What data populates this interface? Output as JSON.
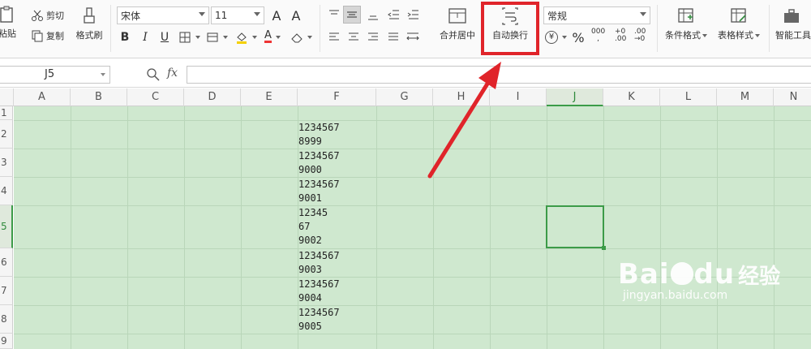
{
  "ribbon": {
    "paste_label": "粘贴",
    "cut_label": "剪切",
    "copy_label": "复制",
    "format_painter_label": "格式刷",
    "font_name": "宋体",
    "font_size": "11",
    "font_grow": "A⁺",
    "font_shrink": "A⁻",
    "merge_center_label": "合并居中",
    "wrap_text_label": "自动换行",
    "number_format": "常规",
    "currency_symbol": "¥",
    "percent_symbol": "%",
    "thousands_symbol": "000",
    "inc_decimal": "+0\n.00",
    "dec_decimal": ".00\n→0",
    "conditional_format_label": "条件格式",
    "table_style_label": "表格样式",
    "smart_tools_label": "智能工具"
  },
  "formula_bar": {
    "name_box": "J5",
    "fx_label": "fx",
    "formula": ""
  },
  "columns": [
    "A",
    "B",
    "C",
    "D",
    "E",
    "F",
    "G",
    "H",
    "I",
    "J",
    "K",
    "L",
    "M",
    "N"
  ],
  "active_column": "J",
  "rows": [
    "1",
    "2",
    "3",
    "4",
    "5",
    "6",
    "7",
    "8",
    "9"
  ],
  "active_row": "5",
  "column_f_cells": [
    {
      "row": "2",
      "lines": "1234567\n8999"
    },
    {
      "row": "3",
      "lines": "1234567\n9000"
    },
    {
      "row": "4",
      "lines": "1234567\n9001"
    },
    {
      "row": "5",
      "lines": "12345\n67\n9002"
    },
    {
      "row": "6",
      "lines": "1234567\n9003"
    },
    {
      "row": "7",
      "lines": "1234567\n9004"
    },
    {
      "row": "8",
      "lines": "1234567\n9005"
    }
  ],
  "watermark": {
    "brand": "Bai",
    "brand2": "du",
    "cn": "经验",
    "url": "jingyan.baidu.com"
  },
  "colors": {
    "sheet_bg": "#cfe8cf",
    "selection": "#3c9b48",
    "highlight_box": "#e0242a"
  }
}
